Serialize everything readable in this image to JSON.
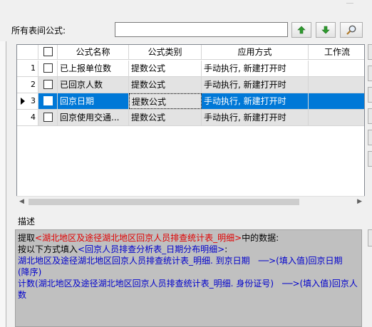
{
  "search": {
    "label": "所有表间公式:",
    "value": "",
    "up_icon": "arrow-up-icon",
    "down_icon": "arrow-down-icon",
    "search_icon": "magnifier-icon"
  },
  "table": {
    "columns": [
      "",
      "公式名称",
      "公式类别",
      "应用方式",
      "工作流"
    ],
    "rows": [
      {
        "num": "1",
        "name": "已上报单位数",
        "category": "提数公式",
        "method": "手动执行, 新建打开时",
        "workflow": ""
      },
      {
        "num": "2",
        "name": "已回京人数",
        "category": "提数公式",
        "method": "手动执行, 新建打开时",
        "workflow": ""
      },
      {
        "num": "3",
        "name": "回京日期",
        "category": "提数公式",
        "method": "手动执行, 新建打开时",
        "workflow": ""
      },
      {
        "num": "4",
        "name": "回京使用交通...",
        "category": "提数公式",
        "method": "手动执行, 新建打开时",
        "workflow": ""
      }
    ],
    "selected_row": 3
  },
  "description": {
    "label": "描述",
    "line1_prefix": "提取",
    "line1_source": "<湖北地区及途径湖北地区回京人员排查统计表_明细>",
    "line1_suffix": "中的数据:",
    "line2_prefix": "按以下方式填入",
    "line2_target": "<回京人员排查分析表_日期分布明细>",
    "line2_suffix": ":",
    "mapping1": "湖北地区及途径湖北地区回京人员排查统计表_明细. 到京日期　──>(填入值)回京日期　(降序)",
    "mapping2": "计数(湖北地区及途径湖北地区回京人员排查统计表_明细. 身份证号)　──>(填入值)回京人数"
  },
  "colors": {
    "selection": "#0078d7",
    "source_text": "#e00000",
    "target_text": "#0000cc"
  }
}
